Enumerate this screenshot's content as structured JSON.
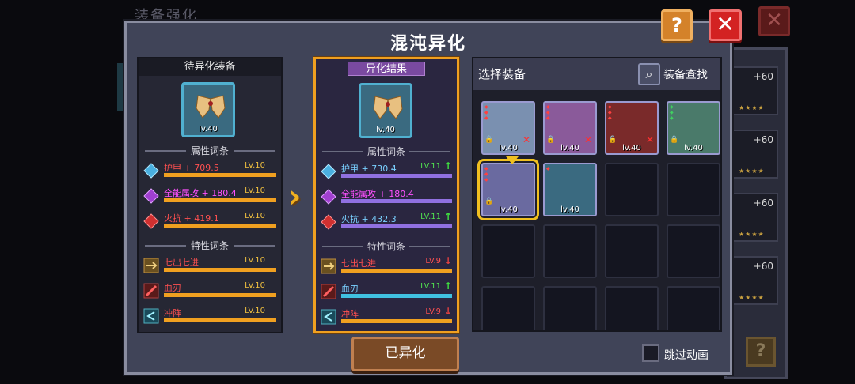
{
  "bg": {
    "title": "装备强化",
    "slots": [
      {
        "plus": "+60",
        "stars": "★★★★"
      },
      {
        "plus": "+60",
        "stars": "★★★★"
      },
      {
        "plus": "+60",
        "stars": "★★★★"
      },
      {
        "plus": "+60",
        "stars": "★★★★"
      }
    ]
  },
  "dialog": {
    "title": "混沌异化",
    "help": "?",
    "close": "✕"
  },
  "source": {
    "header": "待异化装备",
    "item_level": "lv.40",
    "attr_label": "属性词条",
    "trait_label": "特性词条",
    "attrs": [
      {
        "name": "护甲 + 709.5",
        "level": "LV.10",
        "color": "red"
      },
      {
        "name": "全能属攻 + 180.4",
        "level": "LV.10",
        "color": "purple"
      },
      {
        "name": "火抗 + 419.1",
        "level": "LV.10",
        "color": "red"
      }
    ],
    "traits": [
      {
        "name": "七出七进",
        "level": "LV.10"
      },
      {
        "name": "血刃",
        "level": "LV.10"
      },
      {
        "name": "冲阵",
        "level": "LV.10"
      }
    ]
  },
  "result": {
    "header": "异化结果",
    "item_level": "lv.40",
    "attr_label": "属性词条",
    "trait_label": "特性词条",
    "attrs": [
      {
        "name": "护甲 + 730.4",
        "level": "LV.11",
        "arrow": "↑",
        "dir": "up"
      },
      {
        "name": "全能属攻 + 180.4",
        "level": "",
        "arrow": "",
        "dir": ""
      },
      {
        "name": "火抗 + 432.3",
        "level": "LV.11",
        "arrow": "↑",
        "dir": "up"
      }
    ],
    "traits": [
      {
        "name": "七出七进",
        "level": "LV.9",
        "arrow": "↓",
        "dir": "down"
      },
      {
        "name": "血刃",
        "level": "LV.11",
        "arrow": "↑",
        "dir": "up"
      },
      {
        "name": "冲阵",
        "level": "LV.9",
        "arrow": "↓",
        "dir": "down"
      }
    ]
  },
  "inventory": {
    "title": "选择装备",
    "search_label": "装备查找",
    "items": [
      {
        "level": "lv.40",
        "locked": true,
        "x": true
      },
      {
        "level": "lv.40",
        "locked": true,
        "x": true
      },
      {
        "level": "lv.40",
        "locked": true,
        "x": true
      },
      {
        "level": "lv.40",
        "locked": true,
        "x": false
      },
      {
        "level": "lv.40",
        "locked": true,
        "x": false,
        "selected": true
      },
      {
        "level": "lv.40",
        "locked": false,
        "x": false
      }
    ]
  },
  "actions": {
    "main_button": "已异化",
    "skip_label": "跳过动画"
  },
  "colors": {
    "accent": "#f0a020",
    "close": "#d32222",
    "help": "#d4822a"
  }
}
